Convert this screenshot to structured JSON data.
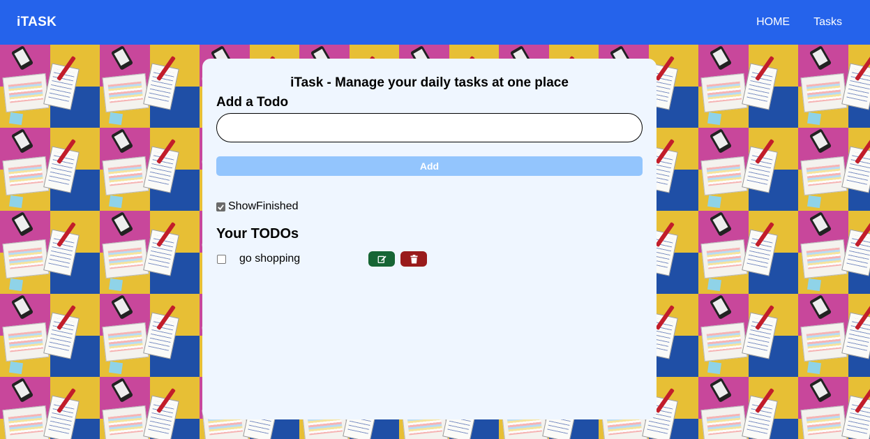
{
  "navbar": {
    "brand": "iTASK",
    "links": [
      {
        "label": "HOME"
      },
      {
        "label": "Tasks"
      }
    ],
    "color": "#2563eb"
  },
  "card": {
    "heading": "iTask - Manage your daily tasks at one place",
    "add_title": "Add a Todo",
    "input": {
      "value": "",
      "placeholder": ""
    },
    "add_button_label": "Add",
    "show_finished": {
      "label": "ShowFinished",
      "checked": true
    },
    "todos_title": "Your TODOs",
    "todos": [
      {
        "text": "go shopping",
        "completed": false
      }
    ]
  },
  "colors": {
    "card_bg": "#eff6ff",
    "add_button": "#93c5fd",
    "edit_button": "#166534",
    "delete_button": "#991b1b"
  },
  "icons": {
    "edit": "edit-icon",
    "delete": "trash-icon"
  }
}
